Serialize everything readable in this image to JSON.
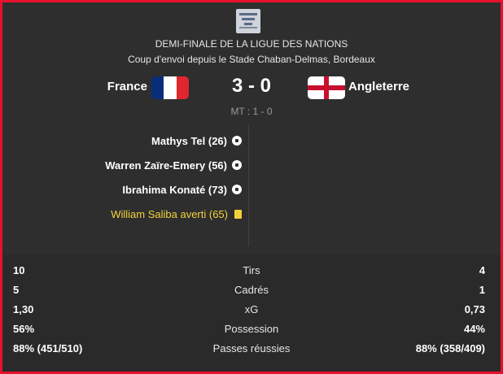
{
  "match": {
    "competition": "DEMI-FINALE DE LA LIGUE DES NATIONS",
    "venue": "Coup d'envoi depuis le Stade Chaban-Delmas, Bordeaux",
    "home_team": "France",
    "away_team": "Angleterre",
    "score": "3 - 0",
    "half_time": "MT : 1 - 0"
  },
  "flags": {
    "france": [
      "#0a2d7a",
      "#ffffff",
      "#e1252e"
    ],
    "england_cross": "#c8102e"
  },
  "events": [
    {
      "text": "Mathys Tel (26)",
      "icon": "goal-ball-icon"
    },
    {
      "text": "Warren Zaïre-Emery (56)",
      "icon": "goal-ball-icon"
    },
    {
      "text": "Ibrahima Konaté (73)",
      "icon": "goal-ball-icon"
    },
    {
      "text": "William Saliba averti (65)",
      "icon": "yellow-card-icon"
    }
  ],
  "stats": [
    {
      "label": "Tirs",
      "home": "10",
      "away": "4"
    },
    {
      "label": "Cadrés",
      "home": "5",
      "away": "1"
    },
    {
      "label": "xG",
      "home": "1,30",
      "away": "0,73"
    },
    {
      "label": "Possession",
      "home": "56%",
      "away": "44%"
    },
    {
      "label": "Passes réussies",
      "home": "88% (451/510)",
      "away": "88% (358/409)"
    }
  ],
  "colors": {
    "border": "#e8112d",
    "panel": "#2e2e2e",
    "yellow_card": "#f2d23c"
  }
}
